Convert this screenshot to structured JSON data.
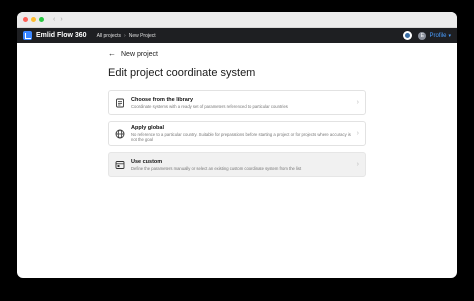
{
  "window": {
    "nav_back": "‹",
    "nav_forward": "›"
  },
  "appbar": {
    "app_name": "Emlid Flow 360",
    "breadcrumb": [
      "All projects",
      "New Project"
    ],
    "breadcrumb_sep": "›",
    "profile_label": "Profile",
    "profile_initial": "E"
  },
  "page": {
    "back_title": "New project",
    "title": "Edit project coordinate system"
  },
  "options": [
    {
      "title": "Choose from the library",
      "desc": "Coordinate systems with a ready set of parameters referenced to particular countries",
      "icon": "library-icon",
      "selected": false
    },
    {
      "title": "Apply global",
      "desc": "No reference to a particular country. Suitable for preparations before starting a project or for projects where accuracy is not the goal",
      "icon": "globe-icon",
      "selected": false
    },
    {
      "title": "Use custom",
      "desc": "Define the parameters manually or select an existing custom coordinate system from the list",
      "icon": "custom-icon",
      "selected": true
    }
  ]
}
